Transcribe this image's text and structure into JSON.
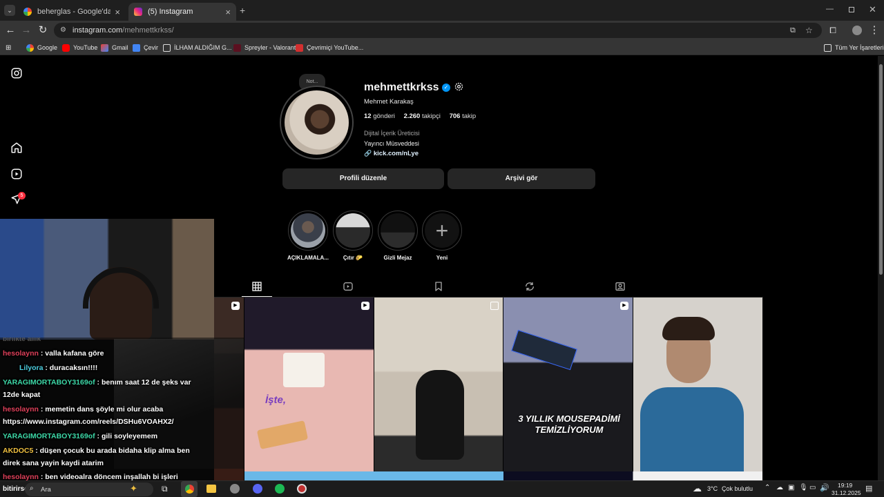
{
  "browser": {
    "tabs": [
      {
        "title": "beherglas - Google'da Ara"
      },
      {
        "title": "(5) Instagram"
      }
    ],
    "url_host": "instagram.com",
    "url_path": "/mehmettkrkss/",
    "bookmarks": [
      "Google",
      "YouTube",
      "Gmail",
      "Çevir",
      "İLHAM ALDIĞIM G...",
      "Spreyler - Valorant",
      "Çevrimiçi YouTube..."
    ],
    "all_bookmarks": "Tüm Yer İşaretleri"
  },
  "sidebar": {
    "notification_count": "5"
  },
  "profile": {
    "note": "Not...",
    "username": "mehmettkrkss",
    "full_name": "Mehmet Karakaş",
    "posts_count": "12",
    "posts_label": "gönderi",
    "followers_count": "2.260",
    "followers_label": "takipçi",
    "following_count": "706",
    "following_label": "takip",
    "category": "Dijital İçerik Üreticisi",
    "bio": "Yayıncı Müsveddesi",
    "link": "kick.com/nLye",
    "edit_button": "Profili düzenle",
    "archive_button": "Arşivi gör"
  },
  "highlights": [
    {
      "label": "AÇIKLAMALA..."
    },
    {
      "label": "Çıtır 🌮"
    },
    {
      "label": "Gizli Mejaz"
    },
    {
      "label": "Yeni"
    }
  ],
  "posts": [
    {
      "caption": ""
    },
    {
      "caption": "İşte,"
    },
    {
      "caption": ""
    },
    {
      "caption": "3 YILLIK MOUSEPADİMİ TEMİZLİYORUM"
    },
    {
      "caption": ""
    }
  ],
  "stream": {
    "faded_line": "birlikte allık",
    "chat": [
      {
        "user": "hesolaynn",
        "color": "#e0405a",
        "text": ": valla kafana göre"
      },
      {
        "user": "Lilyora",
        "color": "#4dd0e1",
        "text": ": duracaksın!!!!"
      },
      {
        "user": "YARAGIMORTABOY3169of",
        "color": "#3dd9a8",
        "text": ": benım saat 12 de şeks var"
      },
      {
        "user": "",
        "color": "#fff",
        "text": "12de kapat"
      },
      {
        "user": "hesolaynn",
        "color": "#e0405a",
        "text": ": memetin dans şöyle mi olur acaba"
      },
      {
        "user": "",
        "color": "#fff",
        "text": "https://www.instagram.com/reels/DSHu6VOAHX2/"
      },
      {
        "user": "YARAGIMORTABOY3169of",
        "color": "#3dd9a8",
        "text": ": gili soyleyemem"
      },
      {
        "user": "AKDOC5",
        "color": "#f0c040",
        "text": ": düşen çocuk bu arada bidaha klip alma ben"
      },
      {
        "user": "",
        "color": "#fff",
        "text": "direk sana yayin kaydi atarim"
      },
      {
        "user": "hesolaynn",
        "color": "#e0405a",
        "text": ": ben videoalra döncem inşallah bi işleri"
      },
      {
        "user": "",
        "color": "#fff",
        "text": "bitirirsem"
      }
    ]
  },
  "taskbar": {
    "search": "Ara",
    "temperature": "3°C",
    "weather": "Çok bulutlu",
    "time": "19:19",
    "date": "31.12.2025"
  },
  "colors": {
    "accent_link": "#e0f1ff",
    "verified": "#0095f6",
    "badge": "#ff3040"
  }
}
